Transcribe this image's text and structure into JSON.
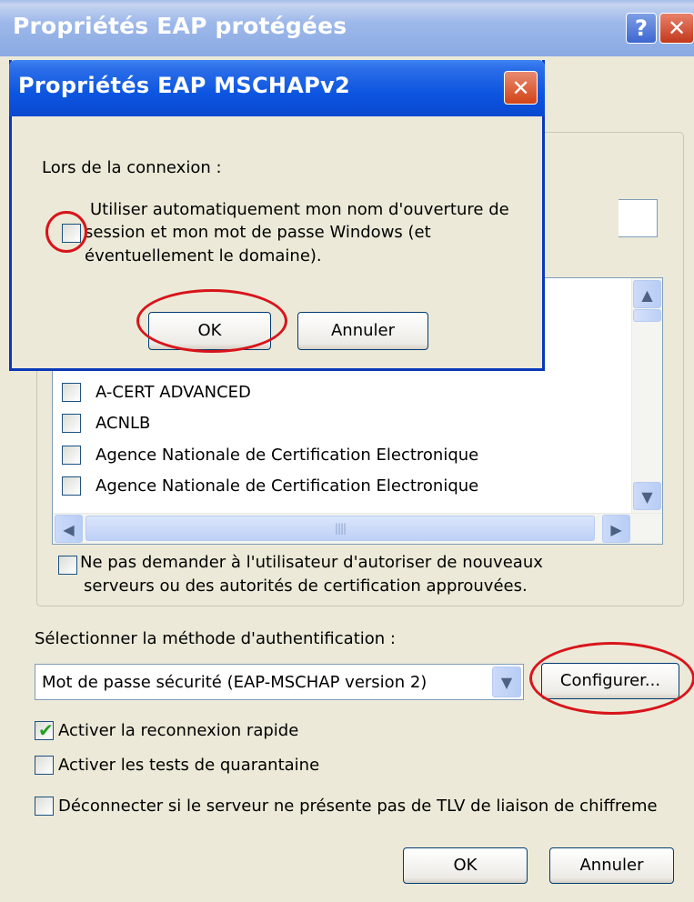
{
  "window": {
    "title": "Propriétés EAP protégées",
    "help_glyph": "?",
    "close_glyph": "✕"
  },
  "cert_list": {
    "items": [
      {
        "label": "A-CERT ADVANCED",
        "checked": false
      },
      {
        "label": "ACNLB",
        "checked": false
      },
      {
        "label": "Agence Nationale de Certification Electronique",
        "checked": false
      },
      {
        "label": "Agence Nationale de Certification Electronique",
        "checked": false
      }
    ],
    "scroll_up_icon": "scroll-up-arrow",
    "scroll_down_icon": "scroll-down-arrow",
    "hthumb_grip": "||||"
  },
  "no_prompt_option": {
    "line1": "Ne pas demander à l'utilisateur d'autoriser de nouveaux",
    "line2": "serveurs ou des autorités de certification approuvées.",
    "checked": false
  },
  "auth_method": {
    "label": "Sélectionner la méthode d'authentification :",
    "selected": "Mot de passe sécurité (EAP-MSCHAP version 2)",
    "configure_label": "Configurer..."
  },
  "options": {
    "fast_reconnect": {
      "label": "Activer la reconnexion rapide",
      "checked": true
    },
    "quarantine": {
      "label": "Activer les tests de quarantaine",
      "checked": false
    },
    "disconnect_tlv": {
      "label": "Déconnecter si le serveur ne présente pas de TLV de liaison de chiffreme",
      "checked": false
    }
  },
  "footer": {
    "ok_label": "OK",
    "cancel_label": "Annuler"
  },
  "dialog": {
    "title": "Propriétés EAP MSCHAPv2",
    "close_glyph": "✕",
    "connection_label": "Lors de la connexion :",
    "auto_logon": {
      "line1": "Utiliser automatiquement mon nom d'ouverture de",
      "line2": "session et mon mot de passe Windows (et",
      "line3": "éventuellement le domaine).",
      "checked": false
    },
    "ok_label": "OK",
    "cancel_label": "Annuler"
  },
  "colors": {
    "window_bg": "#ece9d8",
    "dialog_title_blue": "#0a48d0",
    "highlight_red": "#d8141a",
    "check_green": "#21a121"
  }
}
